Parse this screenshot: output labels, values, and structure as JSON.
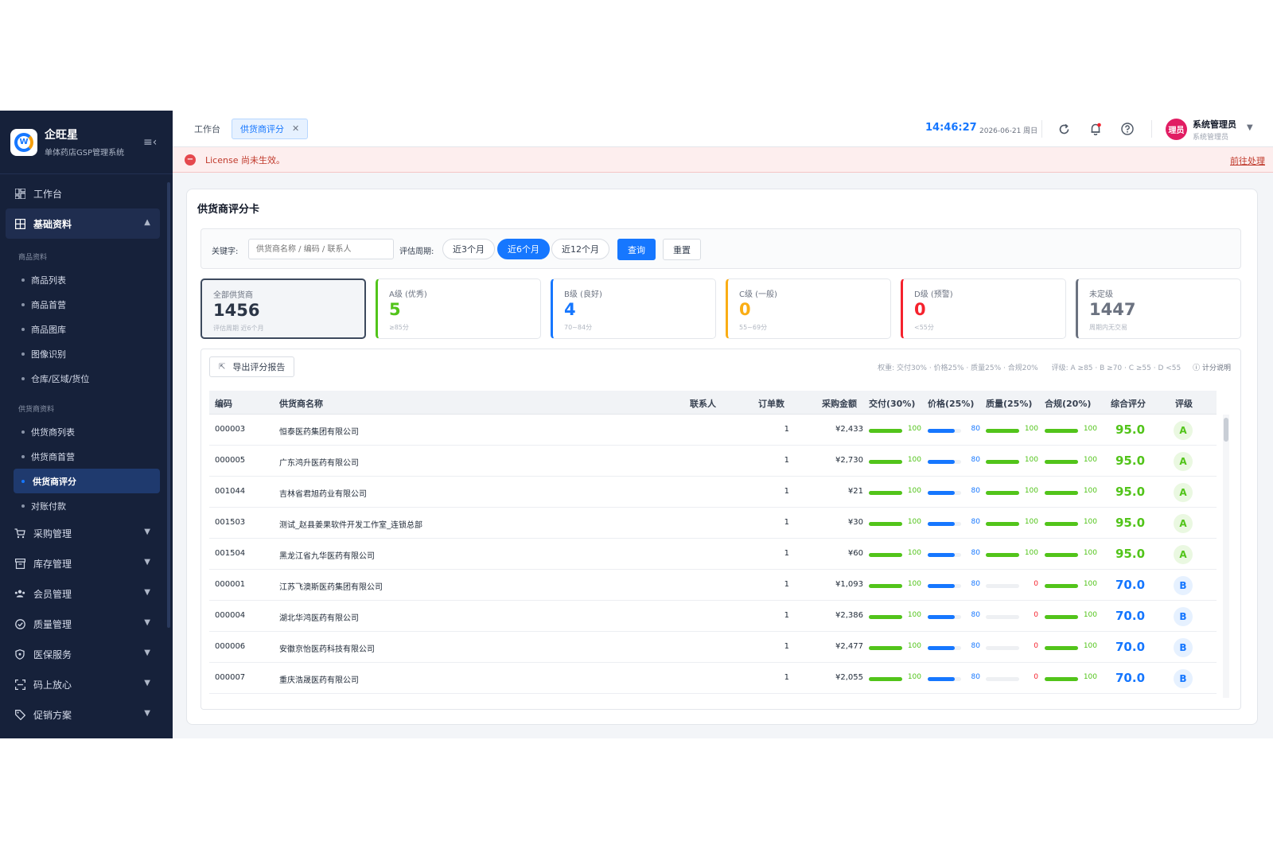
{
  "brand": {
    "title": "企旺星",
    "subtitle": "单体药店GSP管理系统"
  },
  "sidebar": {
    "top_item": "工作台",
    "group_open": "基础资料",
    "section_goods": "商品资料",
    "goods_items": [
      "商品列表",
      "商品首营",
      "商品图库",
      "图像识别",
      "仓库/区域/货位"
    ],
    "section_supplier": "供货商资料",
    "supplier_items": [
      "供货商列表",
      "供货商首营",
      "供货商评分",
      "对账付款"
    ],
    "groups": [
      "采购管理",
      "库存管理",
      "会员管理",
      "质量管理",
      "医保服务",
      "码上放心",
      "促销方案"
    ]
  },
  "topbar": {
    "crumb": "工作台",
    "active_tab": "供货商评分",
    "clock": "14:46:27",
    "date": "2026-06-21 周日",
    "avatar_text": "理员",
    "user_name": "系统管理员",
    "user_role": "系统管理员"
  },
  "alert": {
    "text": "License 尚未生效。",
    "link": "前往处理"
  },
  "card": {
    "title": "供货商评分卡"
  },
  "filter": {
    "keyword_label": "关键字:",
    "keyword_placeholder": "供货商名称 / 编码 / 联系人",
    "period_label": "评估周期:",
    "periods": [
      "近3个月",
      "近6个月",
      "近12个月"
    ],
    "query": "查询",
    "reset": "重置"
  },
  "stats": [
    {
      "label": "全部供货商",
      "value": "1456",
      "sub": "评估周期 近6个月",
      "color": "#2b3546"
    },
    {
      "label": "A级 (优秀)",
      "value": "5",
      "sub": "≥85分",
      "color": "#52c41a"
    },
    {
      "label": "B级 (良好)",
      "value": "4",
      "sub": "70~84分",
      "color": "#1677ff"
    },
    {
      "label": "C级 (一般)",
      "value": "0",
      "sub": "55~69分",
      "color": "#faad14"
    },
    {
      "label": "D级 (预警)",
      "value": "0",
      "sub": "<55分",
      "color": "#f5222d"
    },
    {
      "label": "未定级",
      "value": "1447",
      "sub": "周期内无交易",
      "color": "#6b7280"
    }
  ],
  "table": {
    "export_label": "导出评分报告",
    "weights_note": "权重: 交付30% · 价格25% · 质量25% · 合规20%",
    "grade_note": "评级: A ≥85 · B ≥70 · C ≥55 · D <55",
    "help": "计分说明",
    "headers": [
      "编码",
      "供货商名称",
      "联系人",
      "订单数",
      "采购金额",
      "交付(30%)",
      "价格(25%)",
      "质量(25%)",
      "合规(20%)",
      "综合评分",
      "评级"
    ],
    "rows": [
      {
        "code": "000003",
        "name": "恒泰医药集团有限公司",
        "contact": "",
        "orders": "1",
        "amount": "¥2,433",
        "delivery": 100,
        "price": 80,
        "quality": 100,
        "compliance": 100,
        "total": "95.0",
        "grade": "A"
      },
      {
        "code": "000005",
        "name": "广东鸿升医药有限公司",
        "contact": "",
        "orders": "1",
        "amount": "¥2,730",
        "delivery": 100,
        "price": 80,
        "quality": 100,
        "compliance": 100,
        "total": "95.0",
        "grade": "A"
      },
      {
        "code": "001044",
        "name": "吉林省君旭药业有限公司",
        "contact": "",
        "orders": "1",
        "amount": "¥21",
        "delivery": 100,
        "price": 80,
        "quality": 100,
        "compliance": 100,
        "total": "95.0",
        "grade": "A"
      },
      {
        "code": "001503",
        "name": "测试_赵县姜果软件开发工作室_连锁总部",
        "contact": "",
        "orders": "1",
        "amount": "¥30",
        "delivery": 100,
        "price": 80,
        "quality": 100,
        "compliance": 100,
        "total": "95.0",
        "grade": "A"
      },
      {
        "code": "001504",
        "name": "黑龙江省九华医药有限公司",
        "contact": "",
        "orders": "1",
        "amount": "¥60",
        "delivery": 100,
        "price": 80,
        "quality": 100,
        "compliance": 100,
        "total": "95.0",
        "grade": "A"
      },
      {
        "code": "000001",
        "name": "江苏飞澳斯医药集团有限公司",
        "contact": "",
        "orders": "1",
        "amount": "¥1,093",
        "delivery": 100,
        "price": 80,
        "quality": 0,
        "compliance": 100,
        "total": "70.0",
        "grade": "B"
      },
      {
        "code": "000004",
        "name": "湖北华鸿医药有限公司",
        "contact": "",
        "orders": "1",
        "amount": "¥2,386",
        "delivery": 100,
        "price": 80,
        "quality": 0,
        "compliance": 100,
        "total": "70.0",
        "grade": "B"
      },
      {
        "code": "000006",
        "name": "安徽京怡医药科技有限公司",
        "contact": "",
        "orders": "1",
        "amount": "¥2,477",
        "delivery": 100,
        "price": 80,
        "quality": 0,
        "compliance": 100,
        "total": "70.0",
        "grade": "B"
      },
      {
        "code": "000007",
        "name": "重庆浩晟医药有限公司",
        "contact": "",
        "orders": "1",
        "amount": "¥2,055",
        "delivery": 100,
        "price": 80,
        "quality": 0,
        "compliance": 100,
        "total": "70.0",
        "grade": "B"
      }
    ]
  },
  "colors": {
    "accent": "#1677ff",
    "good": "#52c41a",
    "zero": "#f5222d",
    "sidebar": "#16213a"
  }
}
